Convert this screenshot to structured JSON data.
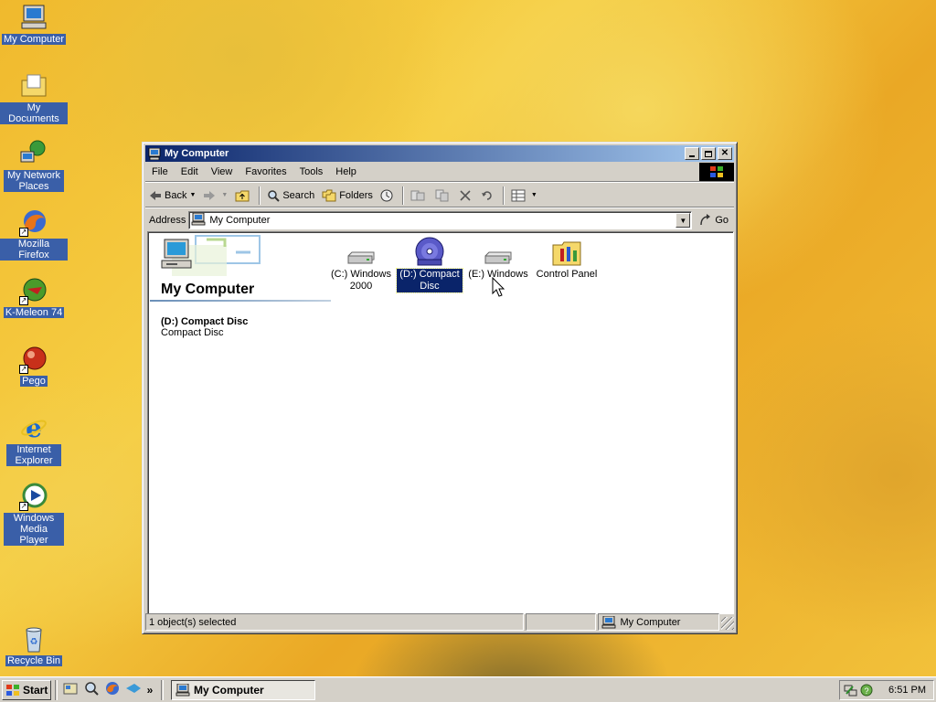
{
  "desktop": {
    "icons": [
      {
        "label": "My Computer",
        "icon": "my-computer-icon"
      },
      {
        "label": "My Documents",
        "icon": "my-documents-icon"
      },
      {
        "label": "My Network Places",
        "icon": "network-places-icon"
      },
      {
        "label": "Mozilla Firefox",
        "icon": "firefox-icon"
      },
      {
        "label": "K-Meleon 74",
        "icon": "k-meleon-icon"
      },
      {
        "label": "Pego",
        "icon": "pego-icon"
      },
      {
        "label": "Internet Explorer",
        "icon": "internet-explorer-icon"
      },
      {
        "label": "Windows Media Player",
        "icon": "media-player-icon"
      },
      {
        "label": "Recycle Bin",
        "icon": "recycle-bin-icon"
      }
    ]
  },
  "window": {
    "title": "My Computer",
    "menu": [
      "File",
      "Edit",
      "View",
      "Favorites",
      "Tools",
      "Help"
    ],
    "toolbar": {
      "back": "Back",
      "search": "Search",
      "folders": "Folders"
    },
    "address": {
      "label": "Address",
      "value": "My Computer",
      "go": "Go"
    },
    "panel": {
      "title": "My Computer",
      "detail_name": "(D:) Compact Disc",
      "detail_type": "Compact Disc"
    },
    "items": [
      {
        "label": "(C:) Windows 2000",
        "icon": "hard-drive-icon",
        "selected": false
      },
      {
        "label": "(D:) Compact Disc",
        "icon": "compact-disc-icon",
        "selected": true
      },
      {
        "label": "(E:) Windows",
        "icon": "hard-drive-icon",
        "selected": false
      },
      {
        "label": "Control Panel",
        "icon": "control-panel-icon",
        "selected": false
      }
    ],
    "status": {
      "selection": "1 object(s) selected",
      "zone": "My Computer"
    }
  },
  "taskbar": {
    "start": "Start",
    "task": "My Computer",
    "clock": "6:51 PM"
  }
}
